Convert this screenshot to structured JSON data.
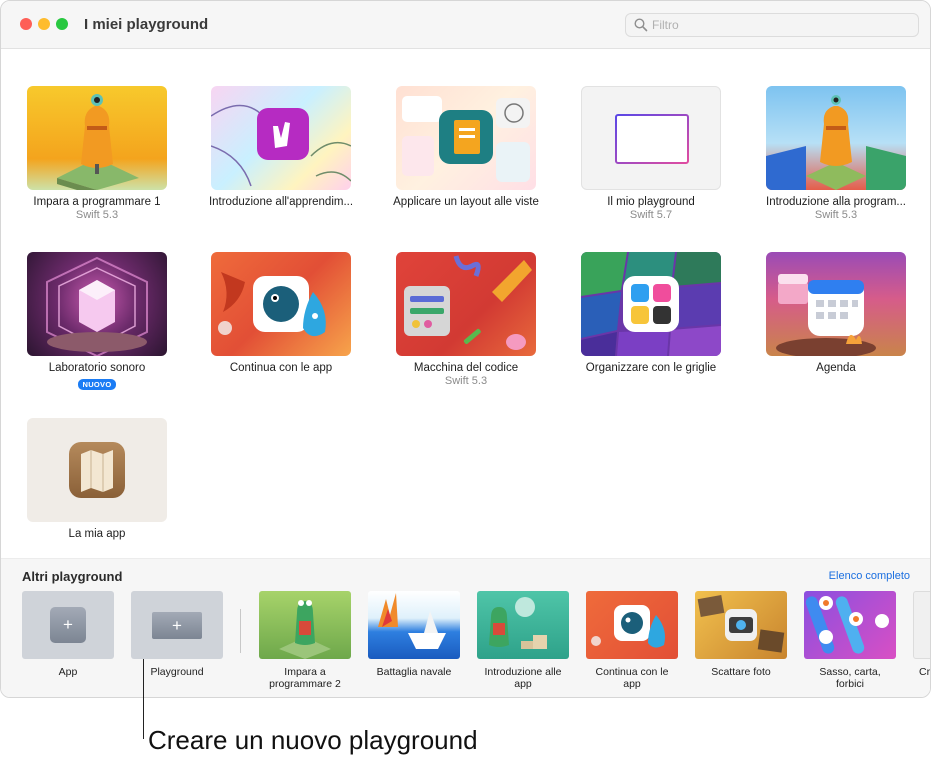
{
  "window": {
    "title": "I miei playground"
  },
  "search": {
    "placeholder": "Filtro",
    "value": ""
  },
  "playgrounds": [
    {
      "title": "Impara a programmare 1",
      "subtitle": "Swift 5.3",
      "badge": ""
    },
    {
      "title": "Introduzione all'apprendim...",
      "subtitle": "",
      "badge": ""
    },
    {
      "title": "Applicare un layout alle viste",
      "subtitle": "",
      "badge": ""
    },
    {
      "title": "Il mio playground",
      "subtitle": "Swift 5.7",
      "badge": ""
    },
    {
      "title": "Introduzione alla program...",
      "subtitle": "Swift 5.3",
      "badge": ""
    },
    {
      "title": "Laboratorio sonoro",
      "subtitle": "",
      "badge": "NUOVO"
    },
    {
      "title": "Continua con le app",
      "subtitle": "",
      "badge": ""
    },
    {
      "title": "Macchina del codice",
      "subtitle": "Swift 5.3",
      "badge": ""
    },
    {
      "title": "Organizzare con le griglie",
      "subtitle": "",
      "badge": ""
    },
    {
      "title": "Agenda",
      "subtitle": "",
      "badge": ""
    },
    {
      "title": "La mia app",
      "subtitle": "",
      "badge": ""
    }
  ],
  "other": {
    "title": "Altri playground",
    "full_list_link": "Elenco completo",
    "new_app": "App",
    "new_playground": "Playground",
    "items": [
      {
        "title": "Impara a programmare 2"
      },
      {
        "title": "Battaglia navale"
      },
      {
        "title": "Introduzione alle app"
      },
      {
        "title": "Continua con le app"
      },
      {
        "title": "Scattare foto"
      },
      {
        "title": "Sasso, carta, forbici"
      },
      {
        "title": "Cr"
      }
    ]
  },
  "callout": {
    "text": "Creare un nuovo playground"
  }
}
